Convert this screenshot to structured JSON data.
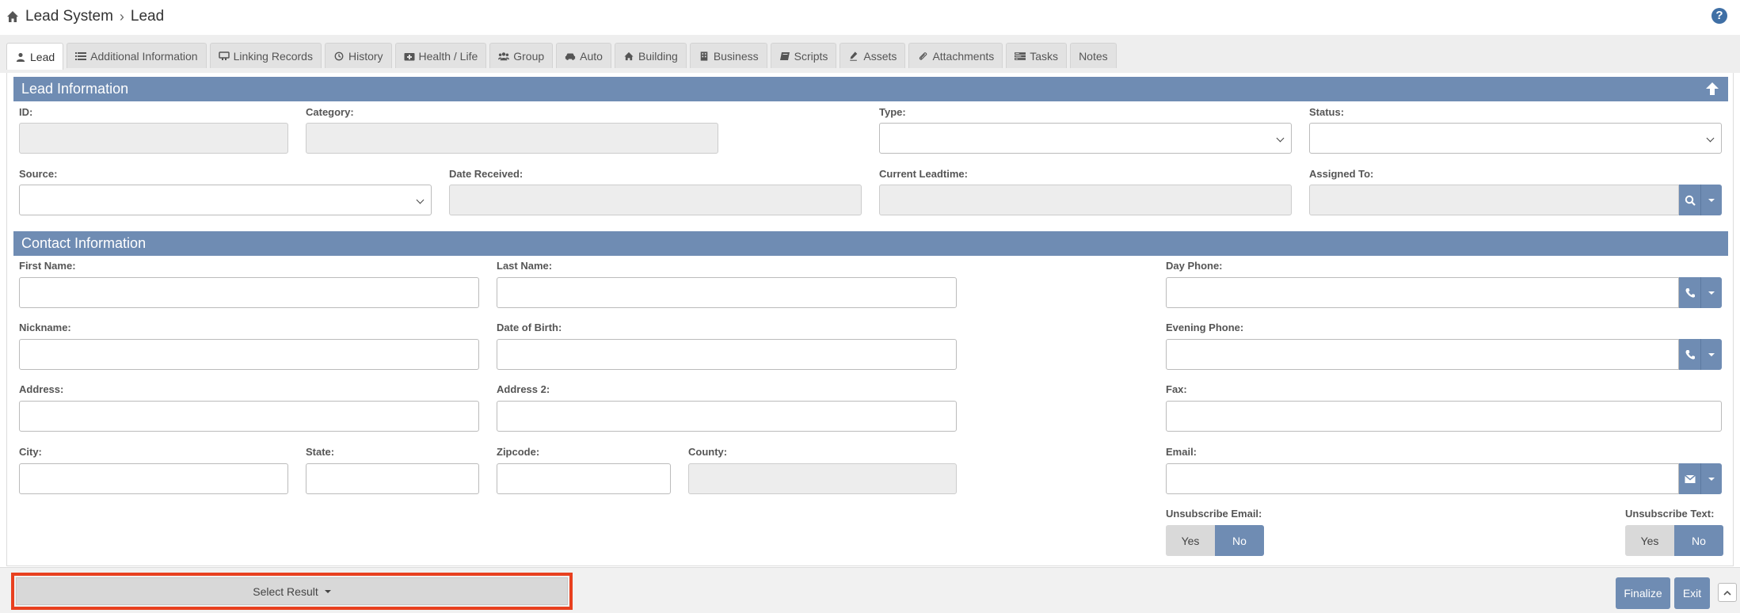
{
  "breadcrumb": {
    "root": "Lead System",
    "current": "Lead"
  },
  "tabs": [
    {
      "label": "Lead",
      "icon": "user-icon"
    },
    {
      "label": "Additional Information",
      "icon": "list-icon"
    },
    {
      "label": "Linking Records",
      "icon": "link-records-icon"
    },
    {
      "label": "History",
      "icon": "history-icon"
    },
    {
      "label": "Health / Life",
      "icon": "medkit-icon"
    },
    {
      "label": "Group",
      "icon": "group-icon"
    },
    {
      "label": "Auto",
      "icon": "car-icon"
    },
    {
      "label": "Building",
      "icon": "home-icon"
    },
    {
      "label": "Business",
      "icon": "building-icon"
    },
    {
      "label": "Scripts",
      "icon": "book-icon"
    },
    {
      "label": "Assets",
      "icon": "pen-icon"
    },
    {
      "label": "Attachments",
      "icon": "paperclip-icon"
    },
    {
      "label": "Tasks",
      "icon": "tasks-icon"
    },
    {
      "label": "Notes",
      "icon": ""
    }
  ],
  "lead_info": {
    "title": "Lead Information",
    "id_label": "ID:",
    "category_label": "Category:",
    "type_label": "Type:",
    "status_label": "Status:",
    "source_label": "Source:",
    "date_received_label": "Date Received:",
    "current_leadtime_label": "Current Leadtime:",
    "assigned_to_label": "Assigned To:"
  },
  "contact_info": {
    "title": "Contact Information",
    "first_name_label": "First Name:",
    "last_name_label": "Last Name:",
    "day_phone_label": "Day Phone:",
    "nickname_label": "Nickname:",
    "dob_label": "Date of Birth:",
    "evening_phone_label": "Evening Phone:",
    "address_label": "Address:",
    "address2_label": "Address 2:",
    "fax_label": "Fax:",
    "city_label": "City:",
    "state_label": "State:",
    "zipcode_label": "Zipcode:",
    "county_label": "County:",
    "email_label": "Email:",
    "unsub_email_label": "Unsubscribe Email:",
    "unsub_text_label": "Unsubscribe Text:",
    "yes": "Yes",
    "no": "No"
  },
  "footer": {
    "select_result": "Select Result",
    "finalize": "Finalize",
    "exit": "Exit"
  },
  "colors": {
    "accent": "#6f8cb3",
    "highlight": "#e8401f"
  }
}
